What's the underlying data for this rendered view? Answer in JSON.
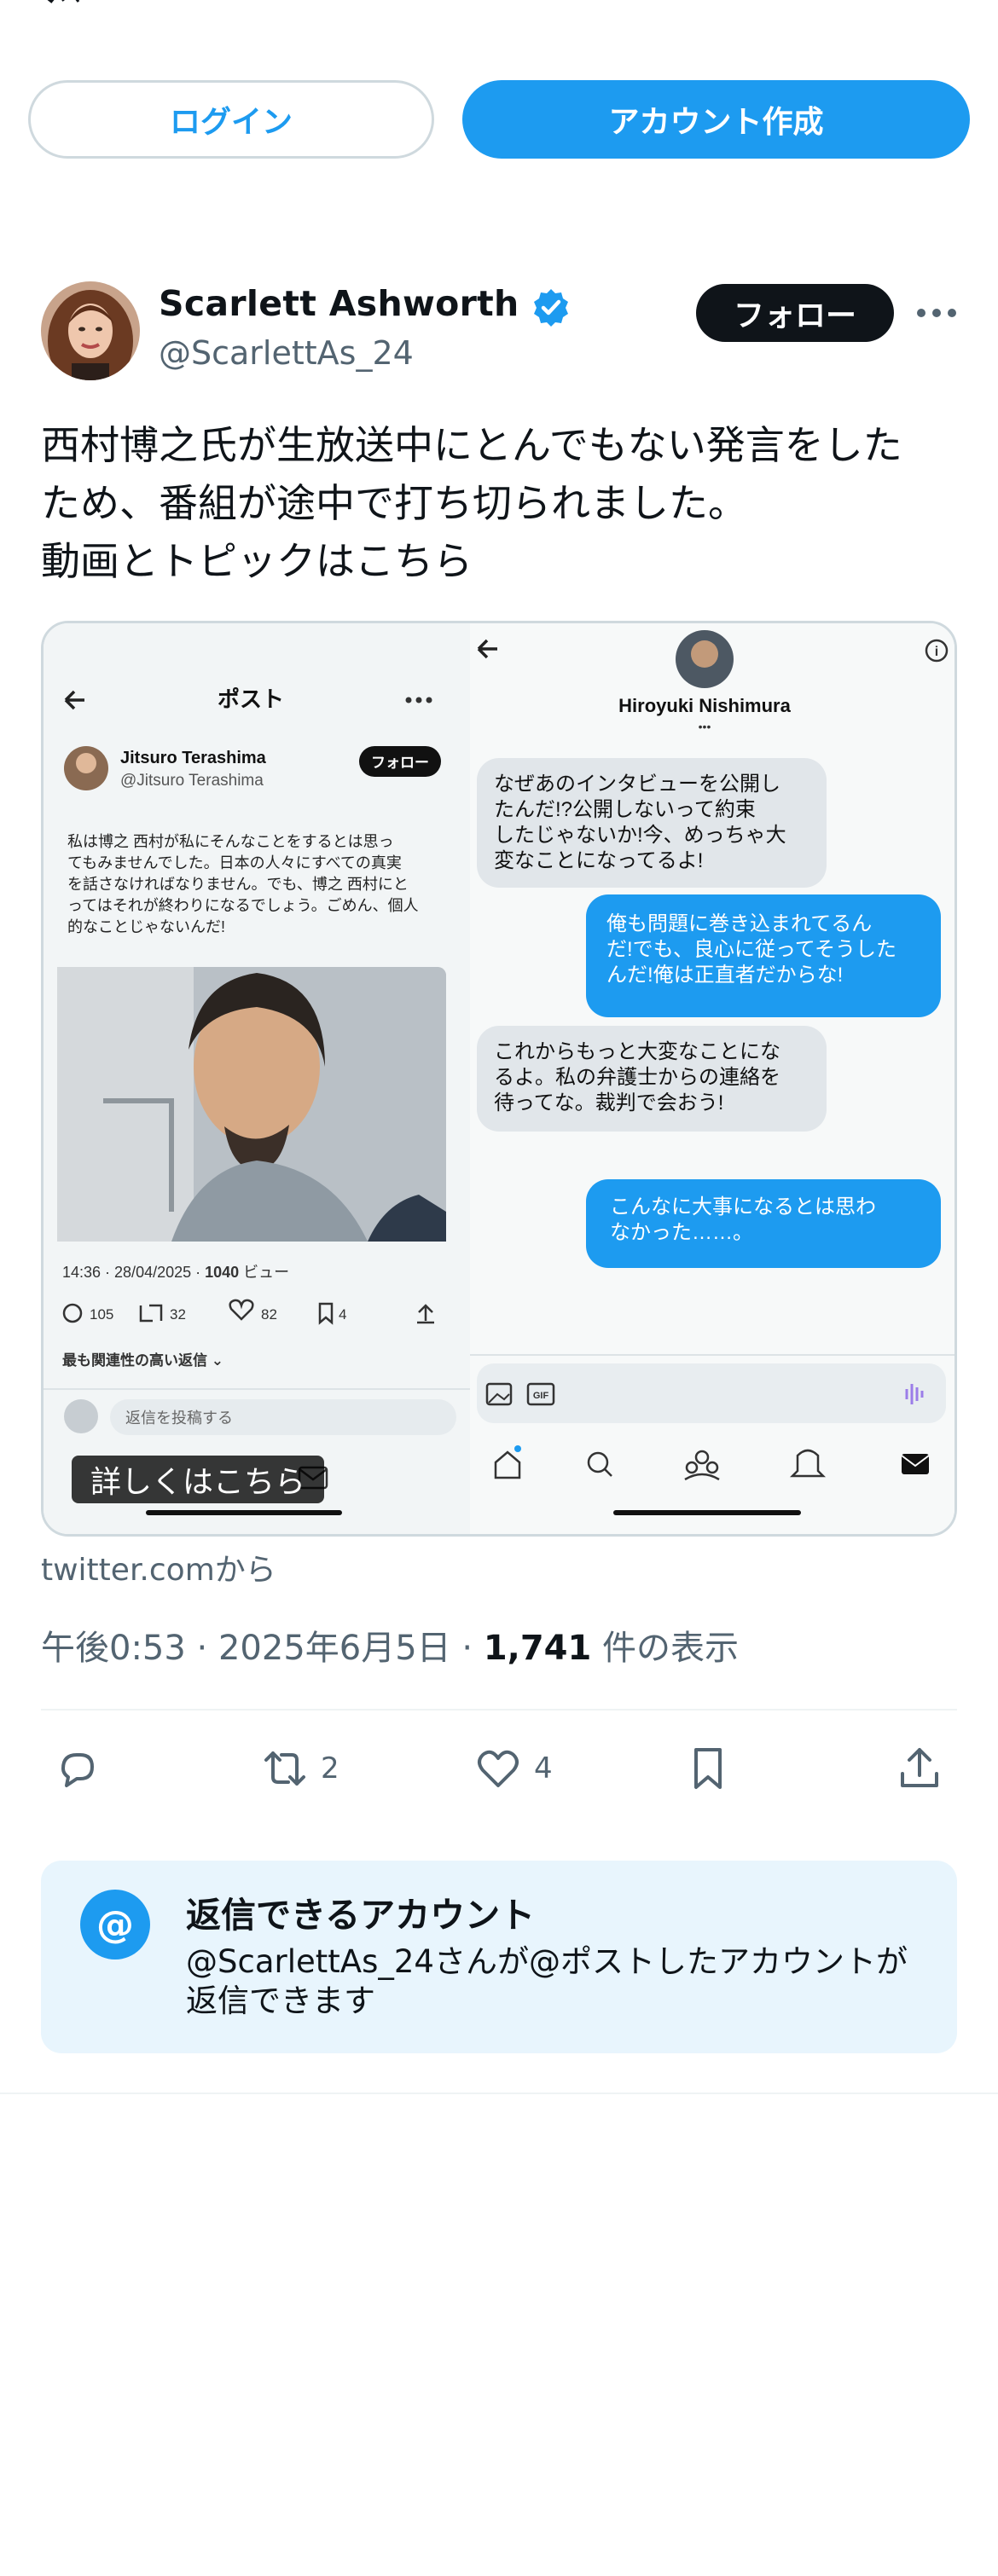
{
  "header": {
    "logo": "x-logo-icon"
  },
  "auth": {
    "login_label": "ログイン",
    "signup_label": "アカウント作成"
  },
  "tweet": {
    "display_name": "Scarlett Ashworth",
    "handle": "@ScarlettAs_24",
    "follow_label": "フォロー",
    "text_lines": [
      "西村博之氏が生放送中にとんでもない発言をした",
      "ため、番組が途中で打ち切られました。",
      "動画とトピックはこちら"
    ],
    "media_badge": "詳しくはこちら",
    "source": "twitter.comから",
    "time": "午後0:53 · 2025年6月5日 · ",
    "views_count": "1,741",
    "views_label": " 件の表示",
    "actions": {
      "reply_count": "",
      "retweet_count": "2",
      "like_count": "4"
    }
  },
  "media": {
    "left_screen": {
      "header_title": "ポスト",
      "author_name": "Jitsuro Terashima",
      "author_handle": "@Jitsuro Terashima",
      "follow_label": "フォロー",
      "body_lines": [
        "私は博之 西村が私にそんなことをするとは思っ",
        "てもみませんでした。日本の人々にすべての真実",
        "を話さなければなりません。でも、博之 西村にと",
        "ってはそれが終わりになるでしょう。ごめん、個人",
        "的なことじゃないんだ!"
      ],
      "timestamp": "14:36 · 28/04/2025 · ",
      "views": "1040",
      "views_label": " ビュー",
      "replies": "105",
      "reposts": "32",
      "likes": "82",
      "bookmarks": "4",
      "sort_label": "最も関連性の高い返信 ⌄",
      "reply_placeholder": "返信を投稿する"
    },
    "right_screen": {
      "contact_name": "Hiroyuki Nishimura",
      "contact_sub": "•••",
      "messages": [
        {
          "side": "in",
          "lines": [
            "なぜあのインタビューを公開し",
            "たんだ!?公開しないって約束",
            "したじゃないか!今、めっちゃ大",
            "変なことになってるよ!"
          ]
        },
        {
          "side": "out",
          "lines": [
            "俺も問題に巻き込まれてるん",
            "だ!でも、良心に従ってそうした",
            "んだ!俺は正直者だからな!"
          ]
        },
        {
          "side": "in",
          "lines": [
            "これからもっと大変なことにな",
            "るよ。私の弁護士からの連絡を",
            "待ってな。裁判で会おう!"
          ]
        },
        {
          "side": "out",
          "lines": [
            "こんなに大事になるとは思わ",
            "なかった……。"
          ]
        }
      ],
      "gif_label": "GIF"
    }
  },
  "reply_settings": {
    "title": "返信できるアカウント",
    "desc": "@ScarlettAs_24さんが@ポストしたアカウントが返信できます"
  },
  "colors": {
    "accent": "#1d9bf0",
    "text": "#0f1419",
    "muted": "#536471",
    "border": "#cfd9de"
  }
}
